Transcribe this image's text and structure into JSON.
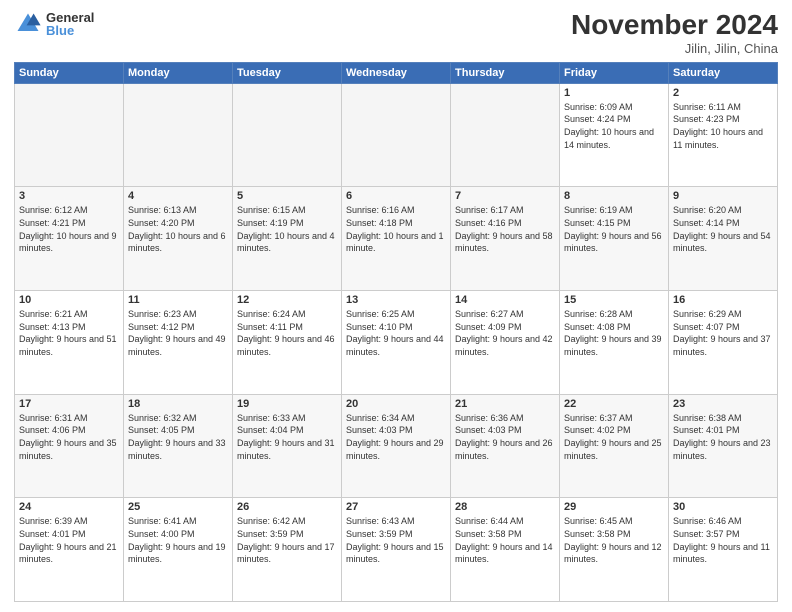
{
  "logo": {
    "general": "General",
    "blue": "Blue"
  },
  "title": "November 2024",
  "location": "Jilin, Jilin, China",
  "days_of_week": [
    "Sunday",
    "Monday",
    "Tuesday",
    "Wednesday",
    "Thursday",
    "Friday",
    "Saturday"
  ],
  "weeks": [
    [
      {
        "day": "",
        "info": "",
        "empty": true
      },
      {
        "day": "",
        "info": "",
        "empty": true
      },
      {
        "day": "",
        "info": "",
        "empty": true
      },
      {
        "day": "",
        "info": "",
        "empty": true
      },
      {
        "day": "",
        "info": "",
        "empty": true
      },
      {
        "day": "1",
        "info": "Sunrise: 6:09 AM\nSunset: 4:24 PM\nDaylight: 10 hours and 14 minutes."
      },
      {
        "day": "2",
        "info": "Sunrise: 6:11 AM\nSunset: 4:23 PM\nDaylight: 10 hours and 11 minutes."
      }
    ],
    [
      {
        "day": "3",
        "info": "Sunrise: 6:12 AM\nSunset: 4:21 PM\nDaylight: 10 hours and 9 minutes."
      },
      {
        "day": "4",
        "info": "Sunrise: 6:13 AM\nSunset: 4:20 PM\nDaylight: 10 hours and 6 minutes."
      },
      {
        "day": "5",
        "info": "Sunrise: 6:15 AM\nSunset: 4:19 PM\nDaylight: 10 hours and 4 minutes."
      },
      {
        "day": "6",
        "info": "Sunrise: 6:16 AM\nSunset: 4:18 PM\nDaylight: 10 hours and 1 minute."
      },
      {
        "day": "7",
        "info": "Sunrise: 6:17 AM\nSunset: 4:16 PM\nDaylight: 9 hours and 58 minutes."
      },
      {
        "day": "8",
        "info": "Sunrise: 6:19 AM\nSunset: 4:15 PM\nDaylight: 9 hours and 56 minutes."
      },
      {
        "day": "9",
        "info": "Sunrise: 6:20 AM\nSunset: 4:14 PM\nDaylight: 9 hours and 54 minutes."
      }
    ],
    [
      {
        "day": "10",
        "info": "Sunrise: 6:21 AM\nSunset: 4:13 PM\nDaylight: 9 hours and 51 minutes."
      },
      {
        "day": "11",
        "info": "Sunrise: 6:23 AM\nSunset: 4:12 PM\nDaylight: 9 hours and 49 minutes."
      },
      {
        "day": "12",
        "info": "Sunrise: 6:24 AM\nSunset: 4:11 PM\nDaylight: 9 hours and 46 minutes."
      },
      {
        "day": "13",
        "info": "Sunrise: 6:25 AM\nSunset: 4:10 PM\nDaylight: 9 hours and 44 minutes."
      },
      {
        "day": "14",
        "info": "Sunrise: 6:27 AM\nSunset: 4:09 PM\nDaylight: 9 hours and 42 minutes."
      },
      {
        "day": "15",
        "info": "Sunrise: 6:28 AM\nSunset: 4:08 PM\nDaylight: 9 hours and 39 minutes."
      },
      {
        "day": "16",
        "info": "Sunrise: 6:29 AM\nSunset: 4:07 PM\nDaylight: 9 hours and 37 minutes."
      }
    ],
    [
      {
        "day": "17",
        "info": "Sunrise: 6:31 AM\nSunset: 4:06 PM\nDaylight: 9 hours and 35 minutes."
      },
      {
        "day": "18",
        "info": "Sunrise: 6:32 AM\nSunset: 4:05 PM\nDaylight: 9 hours and 33 minutes."
      },
      {
        "day": "19",
        "info": "Sunrise: 6:33 AM\nSunset: 4:04 PM\nDaylight: 9 hours and 31 minutes."
      },
      {
        "day": "20",
        "info": "Sunrise: 6:34 AM\nSunset: 4:03 PM\nDaylight: 9 hours and 29 minutes."
      },
      {
        "day": "21",
        "info": "Sunrise: 6:36 AM\nSunset: 4:03 PM\nDaylight: 9 hours and 26 minutes."
      },
      {
        "day": "22",
        "info": "Sunrise: 6:37 AM\nSunset: 4:02 PM\nDaylight: 9 hours and 25 minutes."
      },
      {
        "day": "23",
        "info": "Sunrise: 6:38 AM\nSunset: 4:01 PM\nDaylight: 9 hours and 23 minutes."
      }
    ],
    [
      {
        "day": "24",
        "info": "Sunrise: 6:39 AM\nSunset: 4:01 PM\nDaylight: 9 hours and 21 minutes."
      },
      {
        "day": "25",
        "info": "Sunrise: 6:41 AM\nSunset: 4:00 PM\nDaylight: 9 hours and 19 minutes."
      },
      {
        "day": "26",
        "info": "Sunrise: 6:42 AM\nSunset: 3:59 PM\nDaylight: 9 hours and 17 minutes."
      },
      {
        "day": "27",
        "info": "Sunrise: 6:43 AM\nSunset: 3:59 PM\nDaylight: 9 hours and 15 minutes."
      },
      {
        "day": "28",
        "info": "Sunrise: 6:44 AM\nSunset: 3:58 PM\nDaylight: 9 hours and 14 minutes."
      },
      {
        "day": "29",
        "info": "Sunrise: 6:45 AM\nSunset: 3:58 PM\nDaylight: 9 hours and 12 minutes."
      },
      {
        "day": "30",
        "info": "Sunrise: 6:46 AM\nSunset: 3:57 PM\nDaylight: 9 hours and 11 minutes."
      }
    ]
  ]
}
